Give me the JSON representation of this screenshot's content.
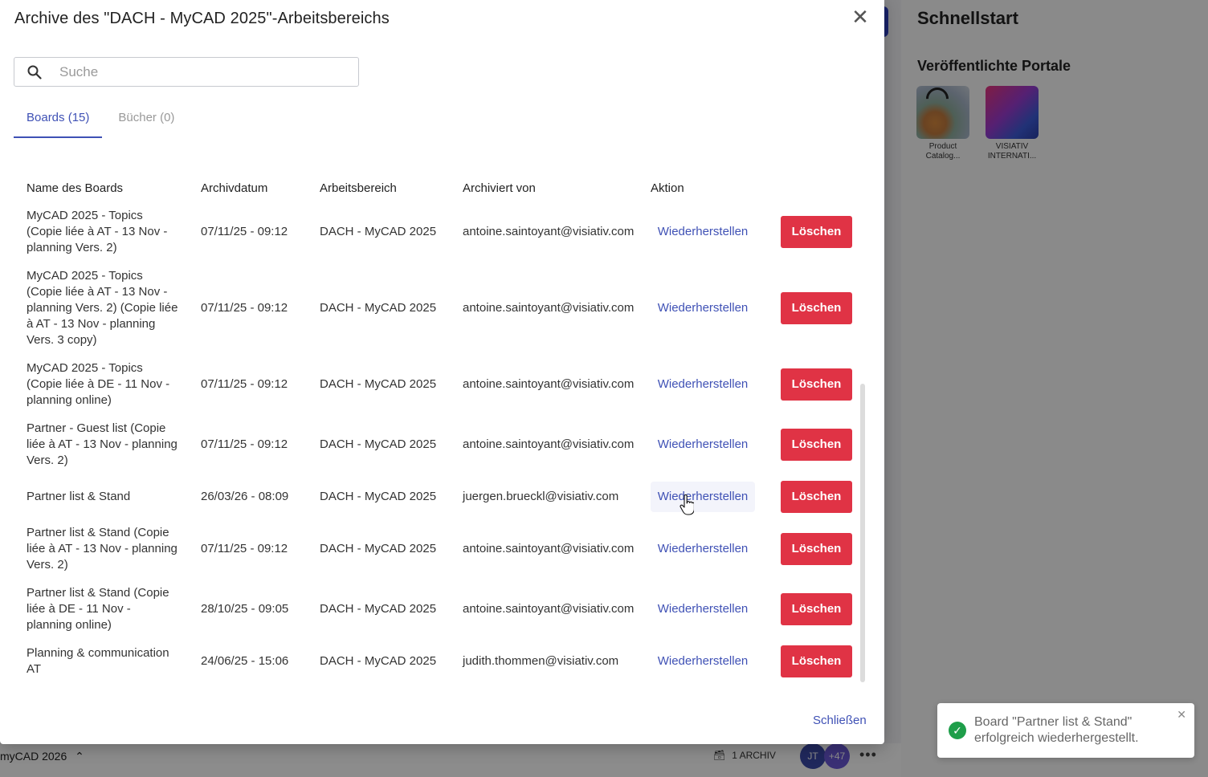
{
  "modal": {
    "title": "Archive des \"DACH - MyCAD 2025\"-Arbeitsbereichs",
    "search_placeholder": "Suche",
    "tabs": [
      {
        "label": "Boards (15)",
        "active": true
      },
      {
        "label": "Bücher (0)",
        "active": false
      }
    ],
    "columns": {
      "name": "Name des Boards",
      "date": "Archivdatum",
      "workspace": "Arbeitsbereich",
      "archived_by": "Archiviert von",
      "action": "Aktion"
    },
    "rows": [
      {
        "name": "MyCAD 2025 - Topics (Copie liée à AT - 13 Nov - planning Vers. 2)",
        "date": "07/11/25 - 09:12",
        "workspace": "DACH - MyCAD 2025",
        "archived_by": "antoine.saintoyant@visiativ.com",
        "restore": "Wiederherstellen",
        "delete": "Löschen"
      },
      {
        "name": "MyCAD 2025 - Topics (Copie liée à AT - 13 Nov - planning Vers. 2) (Copie liée à AT - 13 Nov - planning Vers. 3 copy)",
        "date": "07/11/25 - 09:12",
        "workspace": "DACH - MyCAD 2025",
        "archived_by": "antoine.saintoyant@visiativ.com",
        "restore": "Wiederherstellen",
        "delete": "Löschen"
      },
      {
        "name": "MyCAD 2025 - Topics (Copie liée à DE - 11 Nov - planning online)",
        "date": "07/11/25 - 09:12",
        "workspace": "DACH - MyCAD 2025",
        "archived_by": "antoine.saintoyant@visiativ.com",
        "restore": "Wiederherstellen",
        "delete": "Löschen"
      },
      {
        "name": "Partner - Guest list (Copie liée à AT - 13 Nov - planning Vers. 2)",
        "date": "07/11/25 - 09:12",
        "workspace": "DACH - MyCAD 2025",
        "archived_by": "antoine.saintoyant@visiativ.com",
        "restore": "Wiederherstellen",
        "delete": "Löschen"
      },
      {
        "name": "Partner list & Stand",
        "date": "26/03/26 - 08:09",
        "workspace": "DACH - MyCAD 2025",
        "archived_by": "juergen.brueckl@visiativ.com",
        "restore": "Wiederherstellen",
        "delete": "Löschen",
        "hover": true
      },
      {
        "name": "Partner list & Stand (Copie liée à AT - 13 Nov - planning Vers. 2)",
        "date": "07/11/25 - 09:12",
        "workspace": "DACH - MyCAD 2025",
        "archived_by": "antoine.saintoyant@visiativ.com",
        "restore": "Wiederherstellen",
        "delete": "Löschen"
      },
      {
        "name": "Partner list & Stand (Copie liée à DE - 11 Nov - planning online)",
        "date": "28/10/25 - 09:05",
        "workspace": "DACH - MyCAD 2025",
        "archived_by": "antoine.saintoyant@visiativ.com",
        "restore": "Wiederherstellen",
        "delete": "Löschen"
      },
      {
        "name": "Planning & communication AT",
        "date": "24/06/25 - 15:06",
        "workspace": "DACH - MyCAD 2025",
        "archived_by": "judith.thommen@visiativ.com",
        "restore": "Wiederherstellen",
        "delete": "Löschen"
      }
    ],
    "close_label": "Schließen"
  },
  "background": {
    "quickstart_title": "Schnellstart",
    "portals_title": "Veröffentlichte Portale",
    "portals": [
      {
        "label": "Product Catalog..."
      },
      {
        "label": "VISIATIV INTERNATI..."
      }
    ],
    "workspace_name": "myCAD 2026",
    "archive_count": "1 ARCHIV",
    "avatar_initials": "JT",
    "extra_members": "+47"
  },
  "toast": {
    "message": "Board \"Partner list & Stand\" erfolgreich wiederhergestellt."
  },
  "colors": {
    "accent": "#3f51b5",
    "danger": "#e03345",
    "success": "#1e9e4a"
  }
}
